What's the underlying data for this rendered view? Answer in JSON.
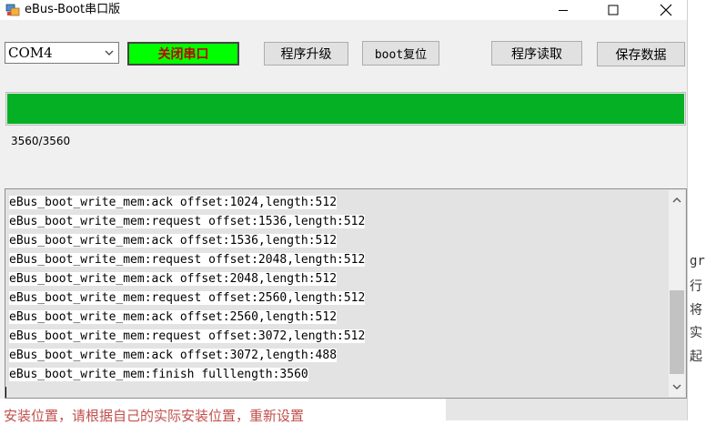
{
  "window": {
    "title": "eBus-Boot串口版"
  },
  "toolbar": {
    "port_selected": "COM4",
    "serial_button": "关闭串口",
    "upgrade_button": "程序升级",
    "boot_reset_button": "boot复位",
    "read_button": "程序读取",
    "save_button": "保存数据"
  },
  "progress": {
    "value": 3560,
    "max": 3560,
    "label": "3560/3560"
  },
  "log": {
    "lines": [
      "eBus_boot_write_mem:ack offset:1024,length:512",
      "eBus_boot_write_mem:request offset:1536,length:512",
      "eBus_boot_write_mem:ack offset:1536,length:512",
      "eBus_boot_write_mem:request offset:2048,length:512",
      "eBus_boot_write_mem:ack offset:2048,length:512",
      "eBus_boot_write_mem:request offset:2560,length:512",
      "eBus_boot_write_mem:ack offset:2560,length:512",
      "eBus_boot_write_mem:request offset:3072,length:512",
      "eBus_boot_write_mem:ack offset:3072,length:488",
      "eBus_boot_write_mem:finish fulllength:3560"
    ]
  },
  "background": {
    "right_glyphs": [
      "gr",
      "行",
      "将",
      "实",
      "起"
    ],
    "bottom_text": "安装位置，请根据自己的实际安装位置，重新设置"
  },
  "colors": {
    "progress": "#06b025",
    "serial_button_bg": "#00ff00",
    "serial_button_text": "#c00000"
  },
  "icons": [
    "app-icon",
    "minimize-icon",
    "maximize-icon",
    "close-icon",
    "chevron-down-icon",
    "scroll-up-icon",
    "scroll-down-icon"
  ]
}
